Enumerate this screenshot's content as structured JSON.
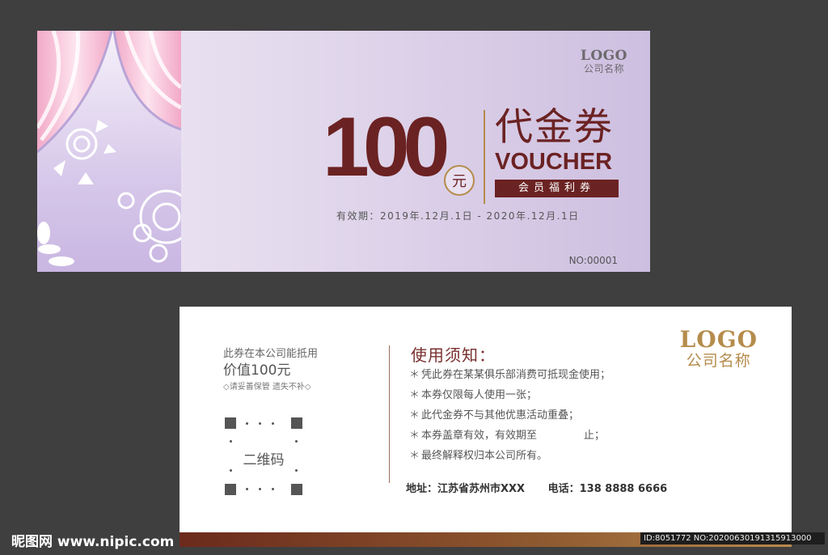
{
  "front": {
    "logo": "LOGO",
    "company": "公司名称",
    "amount": "100",
    "currency": "元",
    "title_cn": "代金券",
    "title_en": "VOUCHER",
    "member": "会员福利券",
    "validity": "有效期：2019年.12月.1日 - 2020年.12月.1日",
    "serial": "NO:00001",
    "colors": {
      "accent": "#6b2222",
      "gold": "#b58c4b",
      "bg": "#d9cfe6"
    }
  },
  "back": {
    "intro1": "此券在本公司能抵用",
    "intro2": "价值100元",
    "intro3": "◇请妥善保管 遗失不补◇",
    "qr_label": "二维码",
    "notice_title": "使用须知：",
    "rules": [
      "凭此券在某某俱乐部消费可抵现金使用；",
      "本券仅限每人使用一张；",
      "此代金券不与其他优惠活动重叠；",
      "本券盖章有效，有效期至              止；",
      "最终解释权归本公司所有。"
    ],
    "address": "地址：江苏省苏州市XXX",
    "phone": "电话：138 8888 6666",
    "logo": "LOGO",
    "company": "公司名称"
  },
  "footer": {
    "watermark": "昵图网 www.nipic.com",
    "image_id": "ID:8051772 NO:20200630191315913000"
  }
}
